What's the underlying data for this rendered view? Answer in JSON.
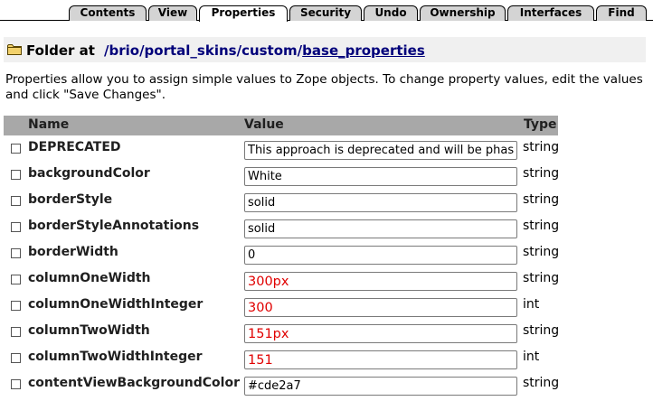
{
  "tabs": [
    {
      "label": "Contents"
    },
    {
      "label": "View"
    },
    {
      "label": "Properties"
    },
    {
      "label": "Security"
    },
    {
      "label": "Undo"
    },
    {
      "label": "Ownership"
    },
    {
      "label": "Interfaces"
    },
    {
      "label": "Find"
    }
  ],
  "active_tab": "Properties",
  "location": {
    "icon": "folder-icon",
    "label": "Folder at",
    "path_segments": [
      "/brio",
      "portal_skins",
      "custom",
      "base_properties"
    ],
    "separators": [
      "/",
      "/",
      "/"
    ]
  },
  "help_text": "Properties allow you to assign simple values to Zope objects. To change property values, edit the values and click \"Save Changes\".",
  "table": {
    "headers": {
      "name": "Name",
      "value": "Value",
      "type": "Type"
    },
    "rows": [
      {
        "name": "DEPRECATED",
        "value": "This approach is deprecated and will be phased out",
        "type": "string"
      },
      {
        "name": "backgroundColor",
        "value": "White",
        "type": "string"
      },
      {
        "name": "borderStyle",
        "value": "solid",
        "type": "string"
      },
      {
        "name": "borderStyleAnnotations",
        "value": "solid",
        "type": "string"
      },
      {
        "name": "borderWidth",
        "value": "0",
        "type": "string"
      },
      {
        "name": "columnOneWidth",
        "value": "300px",
        "type": "string"
      },
      {
        "name": "columnOneWidthInteger",
        "value": "300",
        "type": "int"
      },
      {
        "name": "columnTwoWidth",
        "value": "151px",
        "type": "string"
      },
      {
        "name": "columnTwoWidthInteger",
        "value": "151",
        "type": "int"
      },
      {
        "name": "contentViewBackgroundColor",
        "value": "#cde2a7",
        "type": "string"
      }
    ]
  },
  "colors": {
    "tab_bg": "#d4d4d4",
    "header_bg": "#a8a8a8",
    "location_bg": "#f0f0f0",
    "path_link": "#00007a",
    "highlight_value": "#e00000"
  }
}
